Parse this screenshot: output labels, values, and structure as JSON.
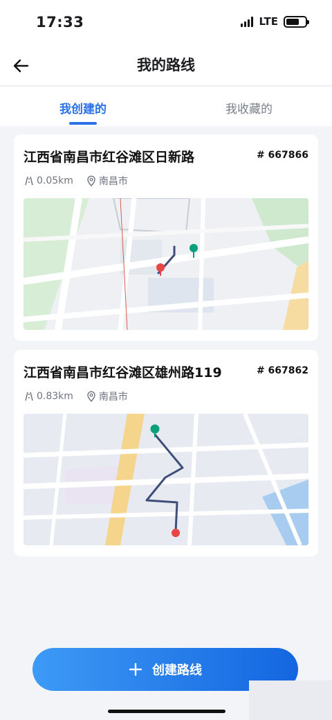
{
  "status_bar": {
    "time": "17:33",
    "network": "LTE"
  },
  "header": {
    "title": "我的路线"
  },
  "tabs": [
    {
      "label": "我创建的",
      "active": true
    },
    {
      "label": "我收藏的",
      "active": false
    }
  ],
  "routes": [
    {
      "title": "江西省南昌市红谷滩区日新路",
      "id": "# 667866",
      "distance": "0.05km",
      "city": "南昌市"
    },
    {
      "title": "江西省南昌市红谷滩区雄州路119",
      "id": "# 667862",
      "distance": "0.83km",
      "city": "南昌市"
    }
  ],
  "footer": {
    "create_label": "创建路线"
  },
  "colors": {
    "accent": "#2b71e8",
    "route_line": "#3f4e78",
    "start_pin": "#0b9e7a",
    "end_pin": "#e84545"
  }
}
